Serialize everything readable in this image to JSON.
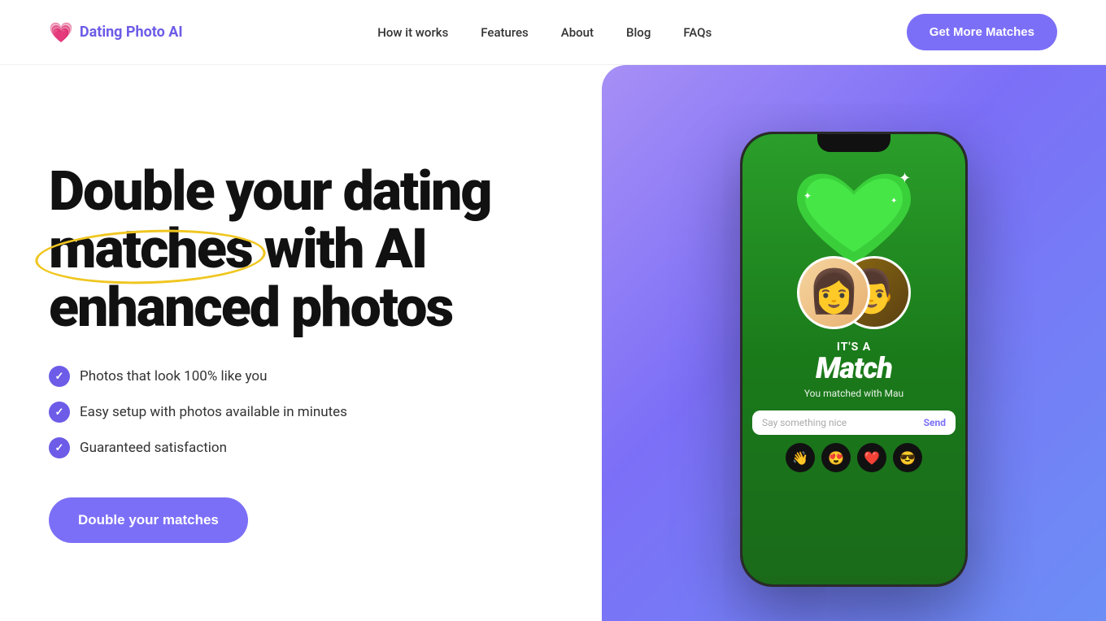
{
  "nav": {
    "logo_icon": "💗",
    "logo_text": "Dating Photo AI",
    "links": [
      {
        "label": "How it works",
        "href": "#"
      },
      {
        "label": "Features",
        "href": "#"
      },
      {
        "label": "About",
        "href": "#"
      },
      {
        "label": "Blog",
        "href": "#"
      },
      {
        "label": "FAQs",
        "href": "#"
      }
    ],
    "cta_label": "Get More Matches"
  },
  "hero": {
    "title_line1": "Double your dating",
    "title_underline": "matches",
    "title_rest": " with AI",
    "title_line3": "enhanced photos",
    "features": [
      "Photos that look 100% like you",
      "Easy setup with photos available in minutes",
      "Guaranteed satisfaction"
    ],
    "cta_label": "Double your matches"
  },
  "phone": {
    "its_a": "IT'S A",
    "match_title": "Match",
    "matched_with": "You matched with Mau",
    "message_placeholder": "Say something nice",
    "send_label": "Send",
    "emojis": [
      "👋",
      "😍",
      "❤️",
      "😎"
    ]
  }
}
